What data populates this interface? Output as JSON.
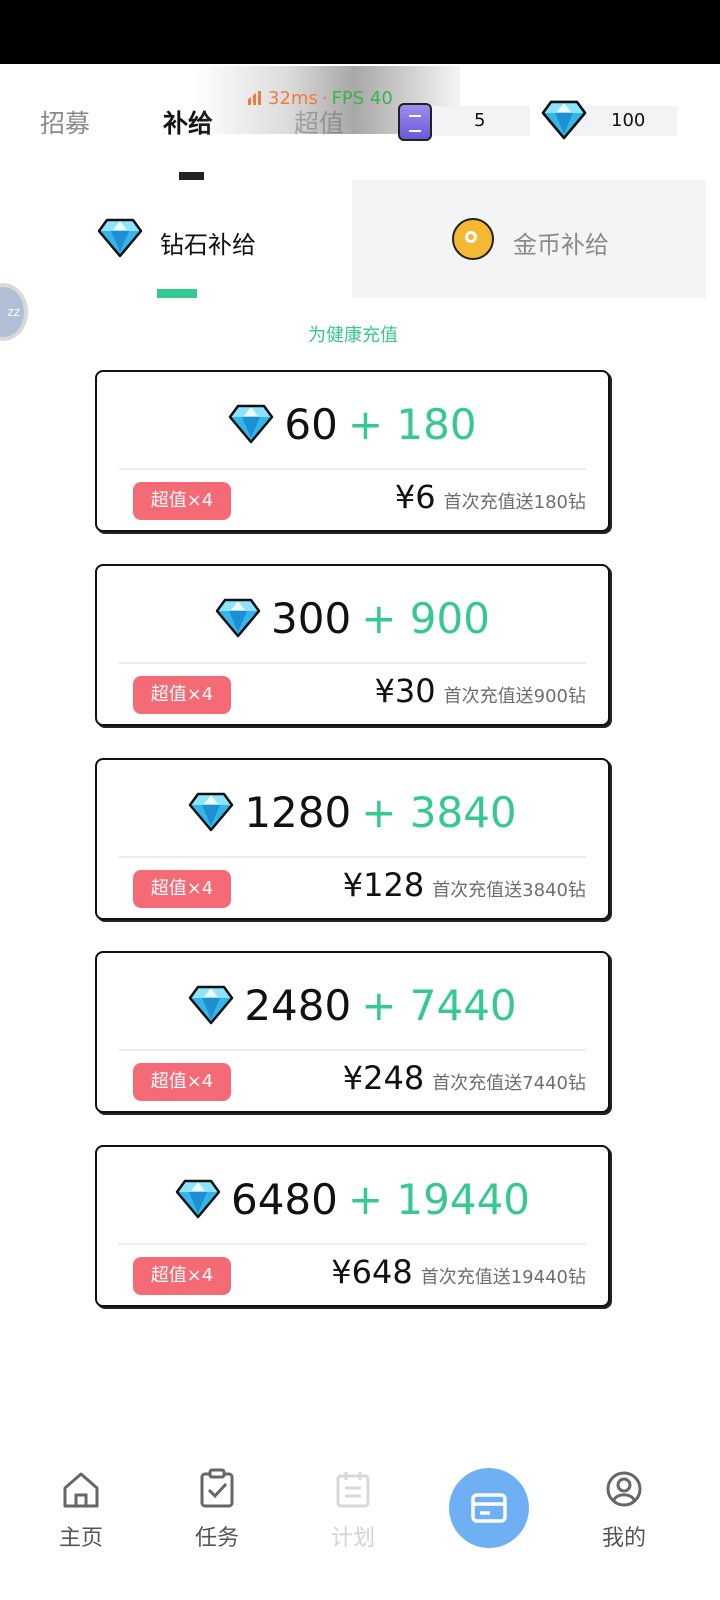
{
  "overlay": {
    "latency": "32ms",
    "separator": "·",
    "fps": "FPS 40"
  },
  "top_tabs": [
    {
      "label": "招募"
    },
    {
      "label": "补给"
    },
    {
      "label": "超值"
    }
  ],
  "resources": {
    "tickets": "5",
    "diamonds": "100"
  },
  "sub_tabs": [
    {
      "label": "钻石补给",
      "icon": "diamond-icon"
    },
    {
      "label": "金币补给",
      "icon": "coin-icon"
    }
  ],
  "side_bubble": "zz",
  "tagline": "为健康充值",
  "packages": [
    {
      "amount": "60",
      "bonus": "+ 180",
      "badge": "超值×4",
      "price": "¥6",
      "note": "首次充值送180钻"
    },
    {
      "amount": "300",
      "bonus": "+ 900",
      "badge": "超值×4",
      "price": "¥30",
      "note": "首次充值送900钻"
    },
    {
      "amount": "1280",
      "bonus": "+ 3840",
      "badge": "超值×4",
      "price": "¥128",
      "note": "首次充值送3840钻"
    },
    {
      "amount": "2480",
      "bonus": "+ 7440",
      "badge": "超值×4",
      "price": "¥248",
      "note": "首次充值送7440钻"
    },
    {
      "amount": "6480",
      "bonus": "+ 19440",
      "badge": "超值×4",
      "price": "¥648",
      "note": "首次充值送19440钻"
    }
  ],
  "nav": [
    {
      "label": "主页",
      "icon": "home-icon"
    },
    {
      "label": "任务",
      "icon": "task-icon"
    },
    {
      "label": "计划",
      "icon": "plan-icon"
    },
    {
      "label": "",
      "icon": "card-icon"
    },
    {
      "label": "我的",
      "icon": "profile-icon"
    }
  ],
  "colors": {
    "accent_green": "#36c98f",
    "badge_red": "#f46b76",
    "nav_center_blue": "#6fb0f5"
  }
}
